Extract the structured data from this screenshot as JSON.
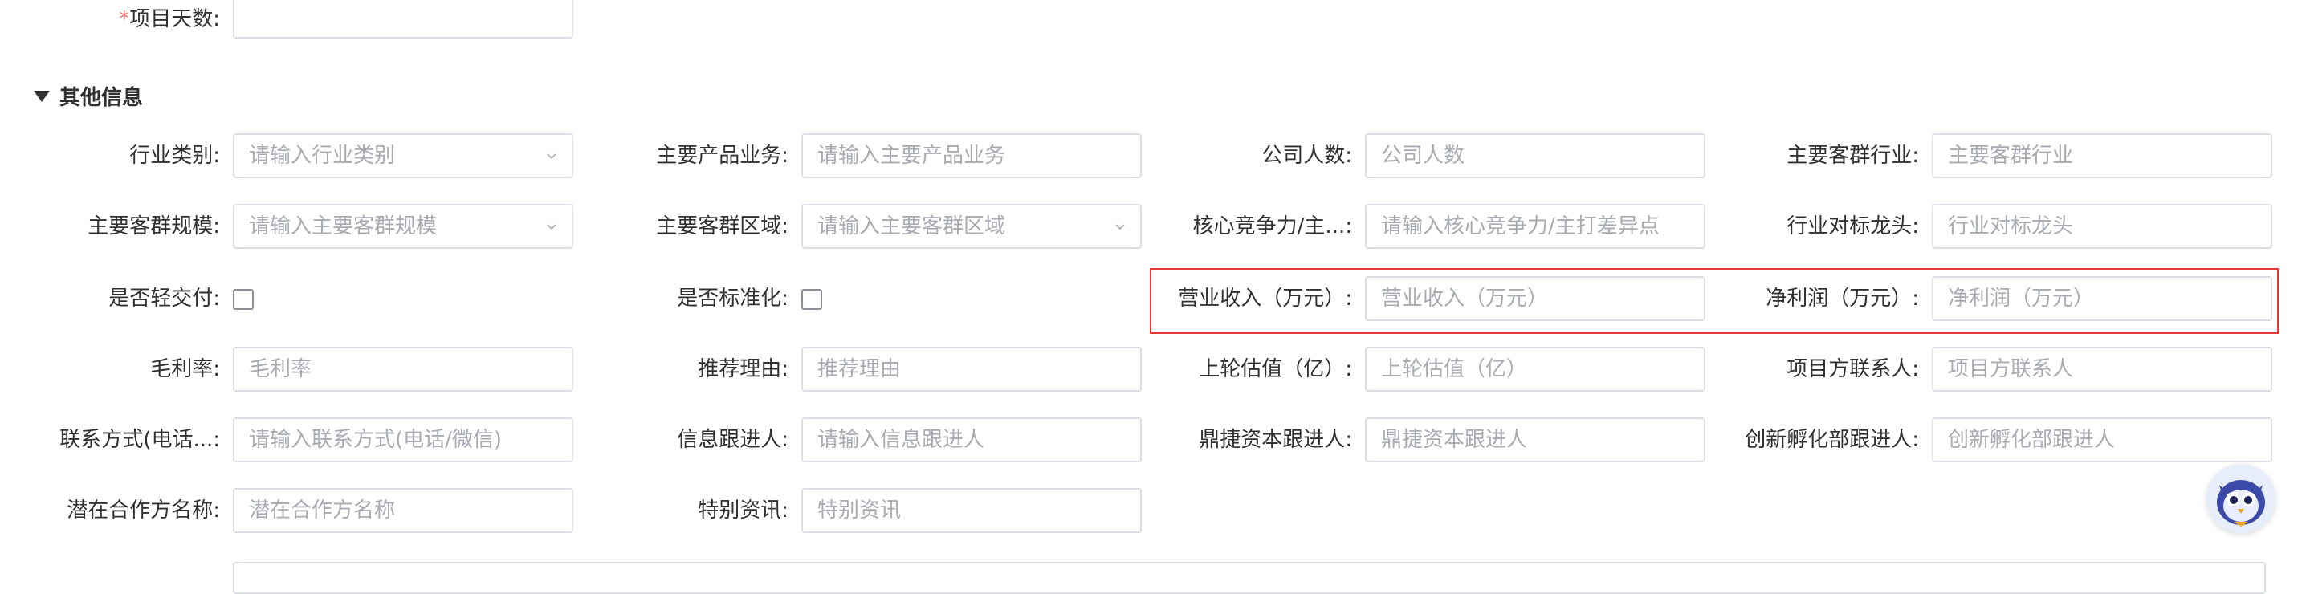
{
  "top": {
    "label": "项目天数:",
    "required_mark": "*"
  },
  "section": {
    "title": "其他信息"
  },
  "rows": [
    [
      {
        "label": "行业类别:",
        "placeholder": "请输入行业类别",
        "type": "select"
      },
      {
        "label": "主要产品业务:",
        "placeholder": "请输入主要产品业务",
        "type": "input"
      },
      {
        "label": "公司人数:",
        "placeholder": "公司人数",
        "type": "input"
      },
      {
        "label": "主要客群行业:",
        "placeholder": "主要客群行业",
        "type": "input"
      }
    ],
    [
      {
        "label": "主要客群规模:",
        "placeholder": "请输入主要客群规模",
        "type": "select"
      },
      {
        "label": "主要客群区域:",
        "placeholder": "请输入主要客群区域",
        "type": "select"
      },
      {
        "label": "核心竞争力/主...:",
        "placeholder": "请输入核心竞争力/主打差异点",
        "type": "input"
      },
      {
        "label": "行业对标龙头:",
        "placeholder": "行业对标龙头",
        "type": "input"
      }
    ],
    [
      {
        "label": "是否轻交付:",
        "type": "checkbox"
      },
      {
        "label": "是否标准化:",
        "type": "checkbox"
      },
      {
        "label": "营业收入（万元）:",
        "placeholder": "营业收入（万元）",
        "type": "input"
      },
      {
        "label": "净利润（万元）:",
        "placeholder": "净利润（万元）",
        "type": "input"
      }
    ],
    [
      {
        "label": "毛利率:",
        "placeholder": "毛利率",
        "type": "input"
      },
      {
        "label": "推荐理由:",
        "placeholder": "推荐理由",
        "type": "input"
      },
      {
        "label": "上轮估值（亿）:",
        "placeholder": "上轮估值（亿）",
        "type": "input"
      },
      {
        "label": "项目方联系人:",
        "placeholder": "项目方联系人",
        "type": "input"
      }
    ],
    [
      {
        "label": "联系方式(电话...:",
        "placeholder": "请输入联系方式(电话/微信)",
        "type": "input"
      },
      {
        "label": "信息跟进人:",
        "placeholder": "请输入信息跟进人",
        "type": "input"
      },
      {
        "label": "鼎捷资本跟进人:",
        "placeholder": "鼎捷资本跟进人",
        "type": "input"
      },
      {
        "label": "创新孵化部跟进人:",
        "placeholder": "创新孵化部跟进人",
        "type": "input"
      }
    ],
    [
      {
        "label": "潜在合作方名称:",
        "placeholder": "潜在合作方名称",
        "type": "input"
      },
      {
        "label": "特别资讯:",
        "placeholder": "特别资讯",
        "type": "input"
      }
    ]
  ],
  "colors": {
    "required": "#f56c6c",
    "highlight_border": "#e53935",
    "placeholder": "#a8abb2",
    "border": "#dcdfe6"
  },
  "icons": {
    "select": "chevron-down-icon",
    "assistant": "owl-assistant-icon"
  }
}
